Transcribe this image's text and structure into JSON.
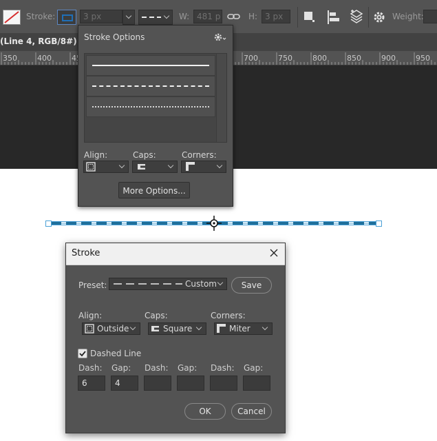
{
  "options_bar": {
    "stroke_label": "Stroke:",
    "stroke_width": "3 px",
    "w_label": "W:",
    "w_value": "481 p",
    "h_label": "H:",
    "h_value": "3 px",
    "weight_label": "Weight:"
  },
  "document": {
    "tab_title": "(Line 4, RGB/8#) *",
    "ruler_ticks": [
      "350",
      "400",
      "45",
      "700",
      "750",
      "800",
      "850",
      "900",
      "950"
    ]
  },
  "stroke_options_panel": {
    "title": "Stroke Options",
    "align_label": "Align:",
    "caps_label": "Caps:",
    "corners_label": "Corners:",
    "more_options_label": "More Options..."
  },
  "stroke_dialog": {
    "title": "Stroke",
    "preset_label": "Preset:",
    "preset_value": "Custom",
    "save_label": "Save",
    "align_label": "Align:",
    "align_value": "Outside",
    "caps_label": "Caps:",
    "caps_value": "Square",
    "corners_label": "Corners:",
    "corners_value": "Miter",
    "dashed_line_label": "Dashed Line",
    "dashed_checked": true,
    "dash_gap_fields": [
      {
        "label": "Dash:",
        "value": "6"
      },
      {
        "label": "Gap:",
        "value": "4"
      },
      {
        "label": "Dash:",
        "value": ""
      },
      {
        "label": "Gap:",
        "value": ""
      },
      {
        "label": "Dash:",
        "value": ""
      },
      {
        "label": "Gap:",
        "value": ""
      }
    ],
    "ok_label": "OK",
    "cancel_label": "Cancel"
  },
  "colors": {
    "panel_bg": "#535353",
    "pasteboard": "#282828",
    "stroke_blue": "#1f6f9b",
    "selection_blue": "#4aa0d6"
  }
}
